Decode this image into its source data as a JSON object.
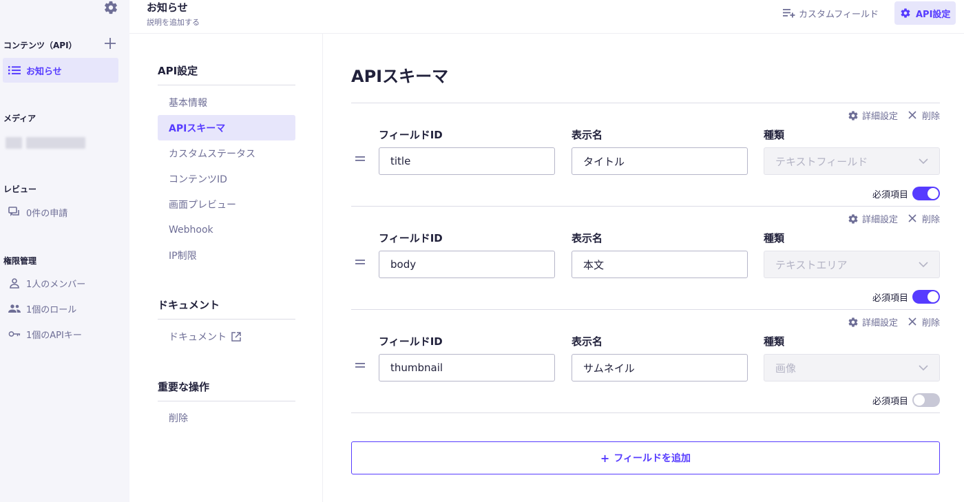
{
  "colors": {
    "accent": "#563bff",
    "accent_bg": "#e7e6fb",
    "muted": "#6e6e96",
    "text": "#21213b"
  },
  "sidebar": {
    "settings_icon": "gear-icon",
    "contents_heading": "コンテンツ（API）",
    "add_icon": "plus-icon",
    "contents_items": [
      {
        "label": "お知らせ",
        "icon": "list-icon"
      }
    ],
    "media_heading": "メディア",
    "review_heading": "レビュー",
    "review_items": [
      {
        "label": "0件の申請",
        "icon": "chat-icon"
      }
    ],
    "permission_heading": "権限管理",
    "permission_items": [
      {
        "label": "1人のメンバー",
        "icon": "person-icon"
      },
      {
        "label": "1個のロール",
        "icon": "people-icon"
      },
      {
        "label": "1個のAPIキー",
        "icon": "key-icon"
      }
    ]
  },
  "header": {
    "title": "お知らせ",
    "description": "説明を追加する",
    "custom_field_label": "カスタムフィールド",
    "api_settings_label": "API設定"
  },
  "settings_nav": {
    "api_heading": "API設定",
    "api_items": [
      "基本情報",
      "APIスキーマ",
      "カスタムステータス",
      "コンテンツID",
      "画面プレビュー",
      "Webhook",
      "IP制限"
    ],
    "active_item": "APIスキーマ",
    "doc_heading": "ドキュメント",
    "doc_item": "ドキュメント",
    "danger_heading": "重要な操作",
    "danger_item": "削除"
  },
  "main": {
    "title": "APIスキーマ",
    "detail_label": "詳細設定",
    "delete_label": "削除",
    "col_field_id": "フィールドID",
    "col_display_name": "表示名",
    "col_type": "種類",
    "required_label": "必須項目",
    "fields": [
      {
        "id": "title",
        "name": "タイトル",
        "type": "テキストフィールド",
        "required": true
      },
      {
        "id": "body",
        "name": "本文",
        "type": "テキストエリア",
        "required": true
      },
      {
        "id": "thumbnail",
        "name": "サムネイル",
        "type": "画像",
        "required": false
      }
    ],
    "add_field_label": "フィールドを追加"
  }
}
